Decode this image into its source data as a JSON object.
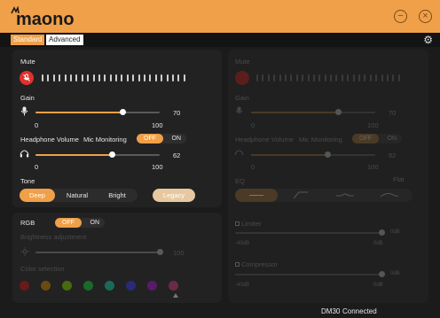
{
  "app": {
    "brand": "maono",
    "status_device": "DM30",
    "status_state": "Connected"
  },
  "tabs": [
    {
      "label": "Standard",
      "active": true
    },
    {
      "label": "Advanced",
      "active": false
    }
  ],
  "colors": {
    "accent": "#f0a048",
    "mute_red": "#e0322e",
    "background": "#1b1b1b",
    "panel": "#222222"
  },
  "left": {
    "mute_label": "Mute",
    "gain_label": "Gain",
    "gain": {
      "value": "70",
      "min": "0",
      "max": "100",
      "level": 0.7
    },
    "headphone_label": "Headphone Volume",
    "monitoring_label": "Mic Monitoring",
    "monitoring_off": "OFF",
    "monitoring_on": "ON",
    "headphone": {
      "value": "62",
      "min": "0",
      "max": "100",
      "level": 0.62
    },
    "tone_label": "Tone",
    "tone_options": [
      "Deep",
      "Natural",
      "Bright"
    ],
    "tone_selected": "Deep",
    "legacy_label": "Legacy"
  },
  "rgb": {
    "label": "RGB",
    "off": "OFF",
    "on": "ON",
    "brightness_label": "Brightness adjustment",
    "brightness_value": "100",
    "brightness_level": 1.0,
    "color_label": "Color selection",
    "swatches": [
      "#6a1a1a",
      "#6a4a10",
      "#4a6a10",
      "#1a6a2a",
      "#1a6a5a",
      "#2a2a7a",
      "#5a1a6a",
      "#6a2a4a"
    ]
  },
  "right": {
    "mute_label": "Mute",
    "gain_label": "Gain",
    "gain": {
      "value": "70",
      "min": "0",
      "max": "100",
      "level": 0.7
    },
    "headphone_label": "Headphone Volume",
    "monitoring_label": "Mic Monitoring",
    "monitoring_off": "OFF",
    "monitoring_on": "ON",
    "headphone": {
      "value": "62",
      "min": "0",
      "max": "100",
      "level": 0.62
    },
    "eq_label": "EQ",
    "eq_mode": "Flat",
    "limiter_label": "Limiter",
    "limiter_min": "-40dB",
    "limiter_max": "0dB",
    "limiter_value": "0dB",
    "compressor_label": "Compressor",
    "compressor_min": "-40dB",
    "compressor_max": "0dB",
    "compressor_value": "0dB"
  },
  "icons": {
    "minimize": "minus-circle-icon",
    "close": "close-circle-icon",
    "settings": "gear-icon"
  }
}
